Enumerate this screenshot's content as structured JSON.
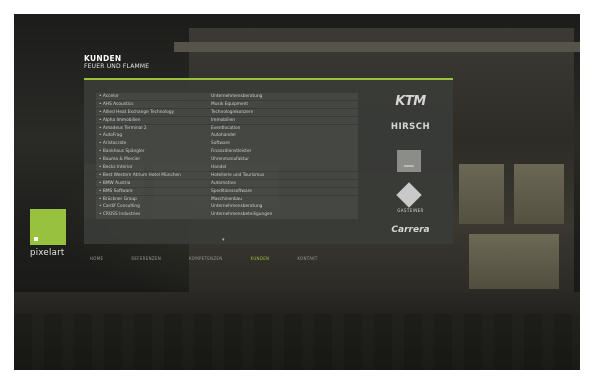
{
  "header": {
    "title": "KUNDEN",
    "subtitle": "FEUER UND FLAMME"
  },
  "clients": [
    {
      "name": "Accelor",
      "industry": "Unternehmensberatung"
    },
    {
      "name": "AHS Acoustics",
      "industry": "Musik Equipment"
    },
    {
      "name": "Allied Heat Exchange Technology",
      "industry": "Technologiekonzern"
    },
    {
      "name": "Alpha Immobilien",
      "industry": "Immobilien"
    },
    {
      "name": "Amadeus Terminal 2",
      "industry": "Eventlocation"
    },
    {
      "name": "AutoFrag",
      "industry": "Autohandel"
    },
    {
      "name": "Aristocrate",
      "industry": "Software"
    },
    {
      "name": "Bankhaus Spängler",
      "industry": "Finanzdienstleister"
    },
    {
      "name": "Bauma & Mercier",
      "industry": "Uhrenmanufaktur"
    },
    {
      "name": "Becks Interior",
      "industry": "Handel"
    },
    {
      "name": "Best Western Atrium Hotel München",
      "industry": "Hotellerie und Tourismus"
    },
    {
      "name": "BMW Austria",
      "industry": "Automotive"
    },
    {
      "name": "BMS Software",
      "industry": "Speditionssoftware"
    },
    {
      "name": "Brückner Group",
      "industry": "Maschinenbau"
    },
    {
      "name": "Cardif Consulting",
      "industry": "Unternehmensberatung"
    },
    {
      "name": "CROSS Industries",
      "industry": "Unternehmensbeteiligungen"
    }
  ],
  "more_indicator": "▾",
  "logos": {
    "ktm": "KTM",
    "hirsch": "HIRSCH",
    "kaindl": "KAINDL",
    "gastein": "GASTEINER",
    "carrera": "Carrera"
  },
  "brand": {
    "name": "pixelart",
    "color": "#98c13d"
  },
  "nav": [
    {
      "label": "HOME",
      "active": false
    },
    {
      "label": "REFERENZEN",
      "active": false
    },
    {
      "label": "KOMPETENZEN",
      "active": false
    },
    {
      "label": "KUNDEN",
      "active": true
    },
    {
      "label": "KONTAKT",
      "active": false
    }
  ]
}
